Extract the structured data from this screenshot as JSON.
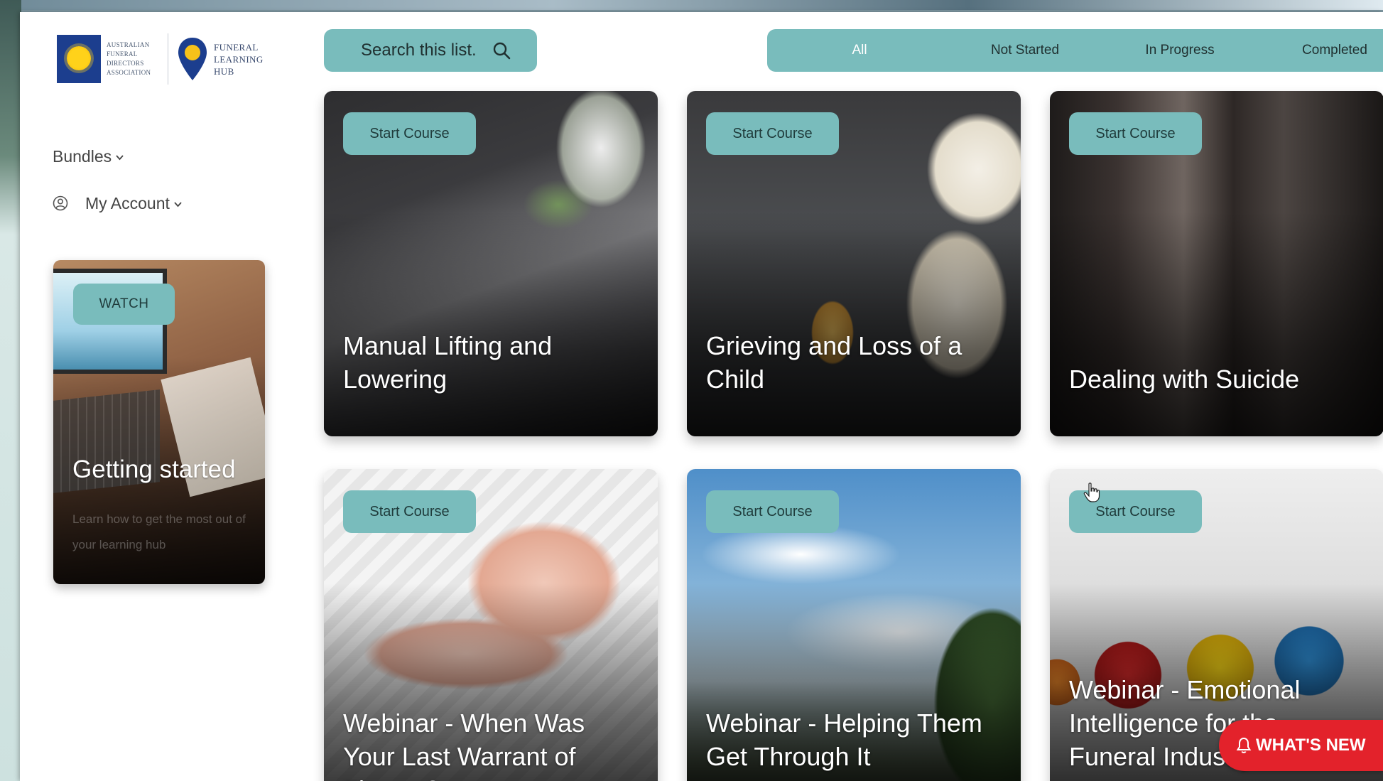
{
  "logo": {
    "afda_lines": [
      "AUSTRALIAN",
      "FUNERAL",
      "DIRECTORS",
      "ASSOCIATION"
    ],
    "flh_lines": [
      "FUNERAL",
      "LEARNING",
      "HUB"
    ]
  },
  "sidebar": {
    "items": [
      {
        "label": "Bundles",
        "icon": "chevron-down-icon"
      },
      {
        "label": "My Account",
        "icon": "user-circle-icon"
      }
    ],
    "watch_card": {
      "button": "WATCH",
      "title": "Getting started",
      "description": "Learn how to get the most out of your learning hub"
    }
  },
  "search": {
    "label": "Search this list.",
    "icon": "search-icon"
  },
  "filters": [
    {
      "label": "All",
      "active": true
    },
    {
      "label": "Not Started",
      "active": false
    },
    {
      "label": "In Progress",
      "active": false
    },
    {
      "label": "Completed",
      "active": false
    }
  ],
  "courses": [
    {
      "button": "Start Course",
      "title": "Manual Lifting and Lowering"
    },
    {
      "button": "Start Course",
      "title": "Grieving and Loss of a Child"
    },
    {
      "button": "Start Course",
      "title": "Dealing with Suicide"
    },
    {
      "button": "Start Course",
      "title": "Webinar - When Was Your Last Warrant of Fitness?"
    },
    {
      "button": "Start Course",
      "title": "Webinar - Helping Them Get Through It"
    },
    {
      "button": "Start Course",
      "title": "Webinar - Emotional Intelligence for the Funeral Industry"
    }
  ],
  "whats_new": {
    "label": "WHAT'S NEW",
    "icon": "bell-icon"
  },
  "colors": {
    "accent": "#79bcbc",
    "alert": "#e3222b",
    "brand_navy": "#1c3e8e"
  }
}
